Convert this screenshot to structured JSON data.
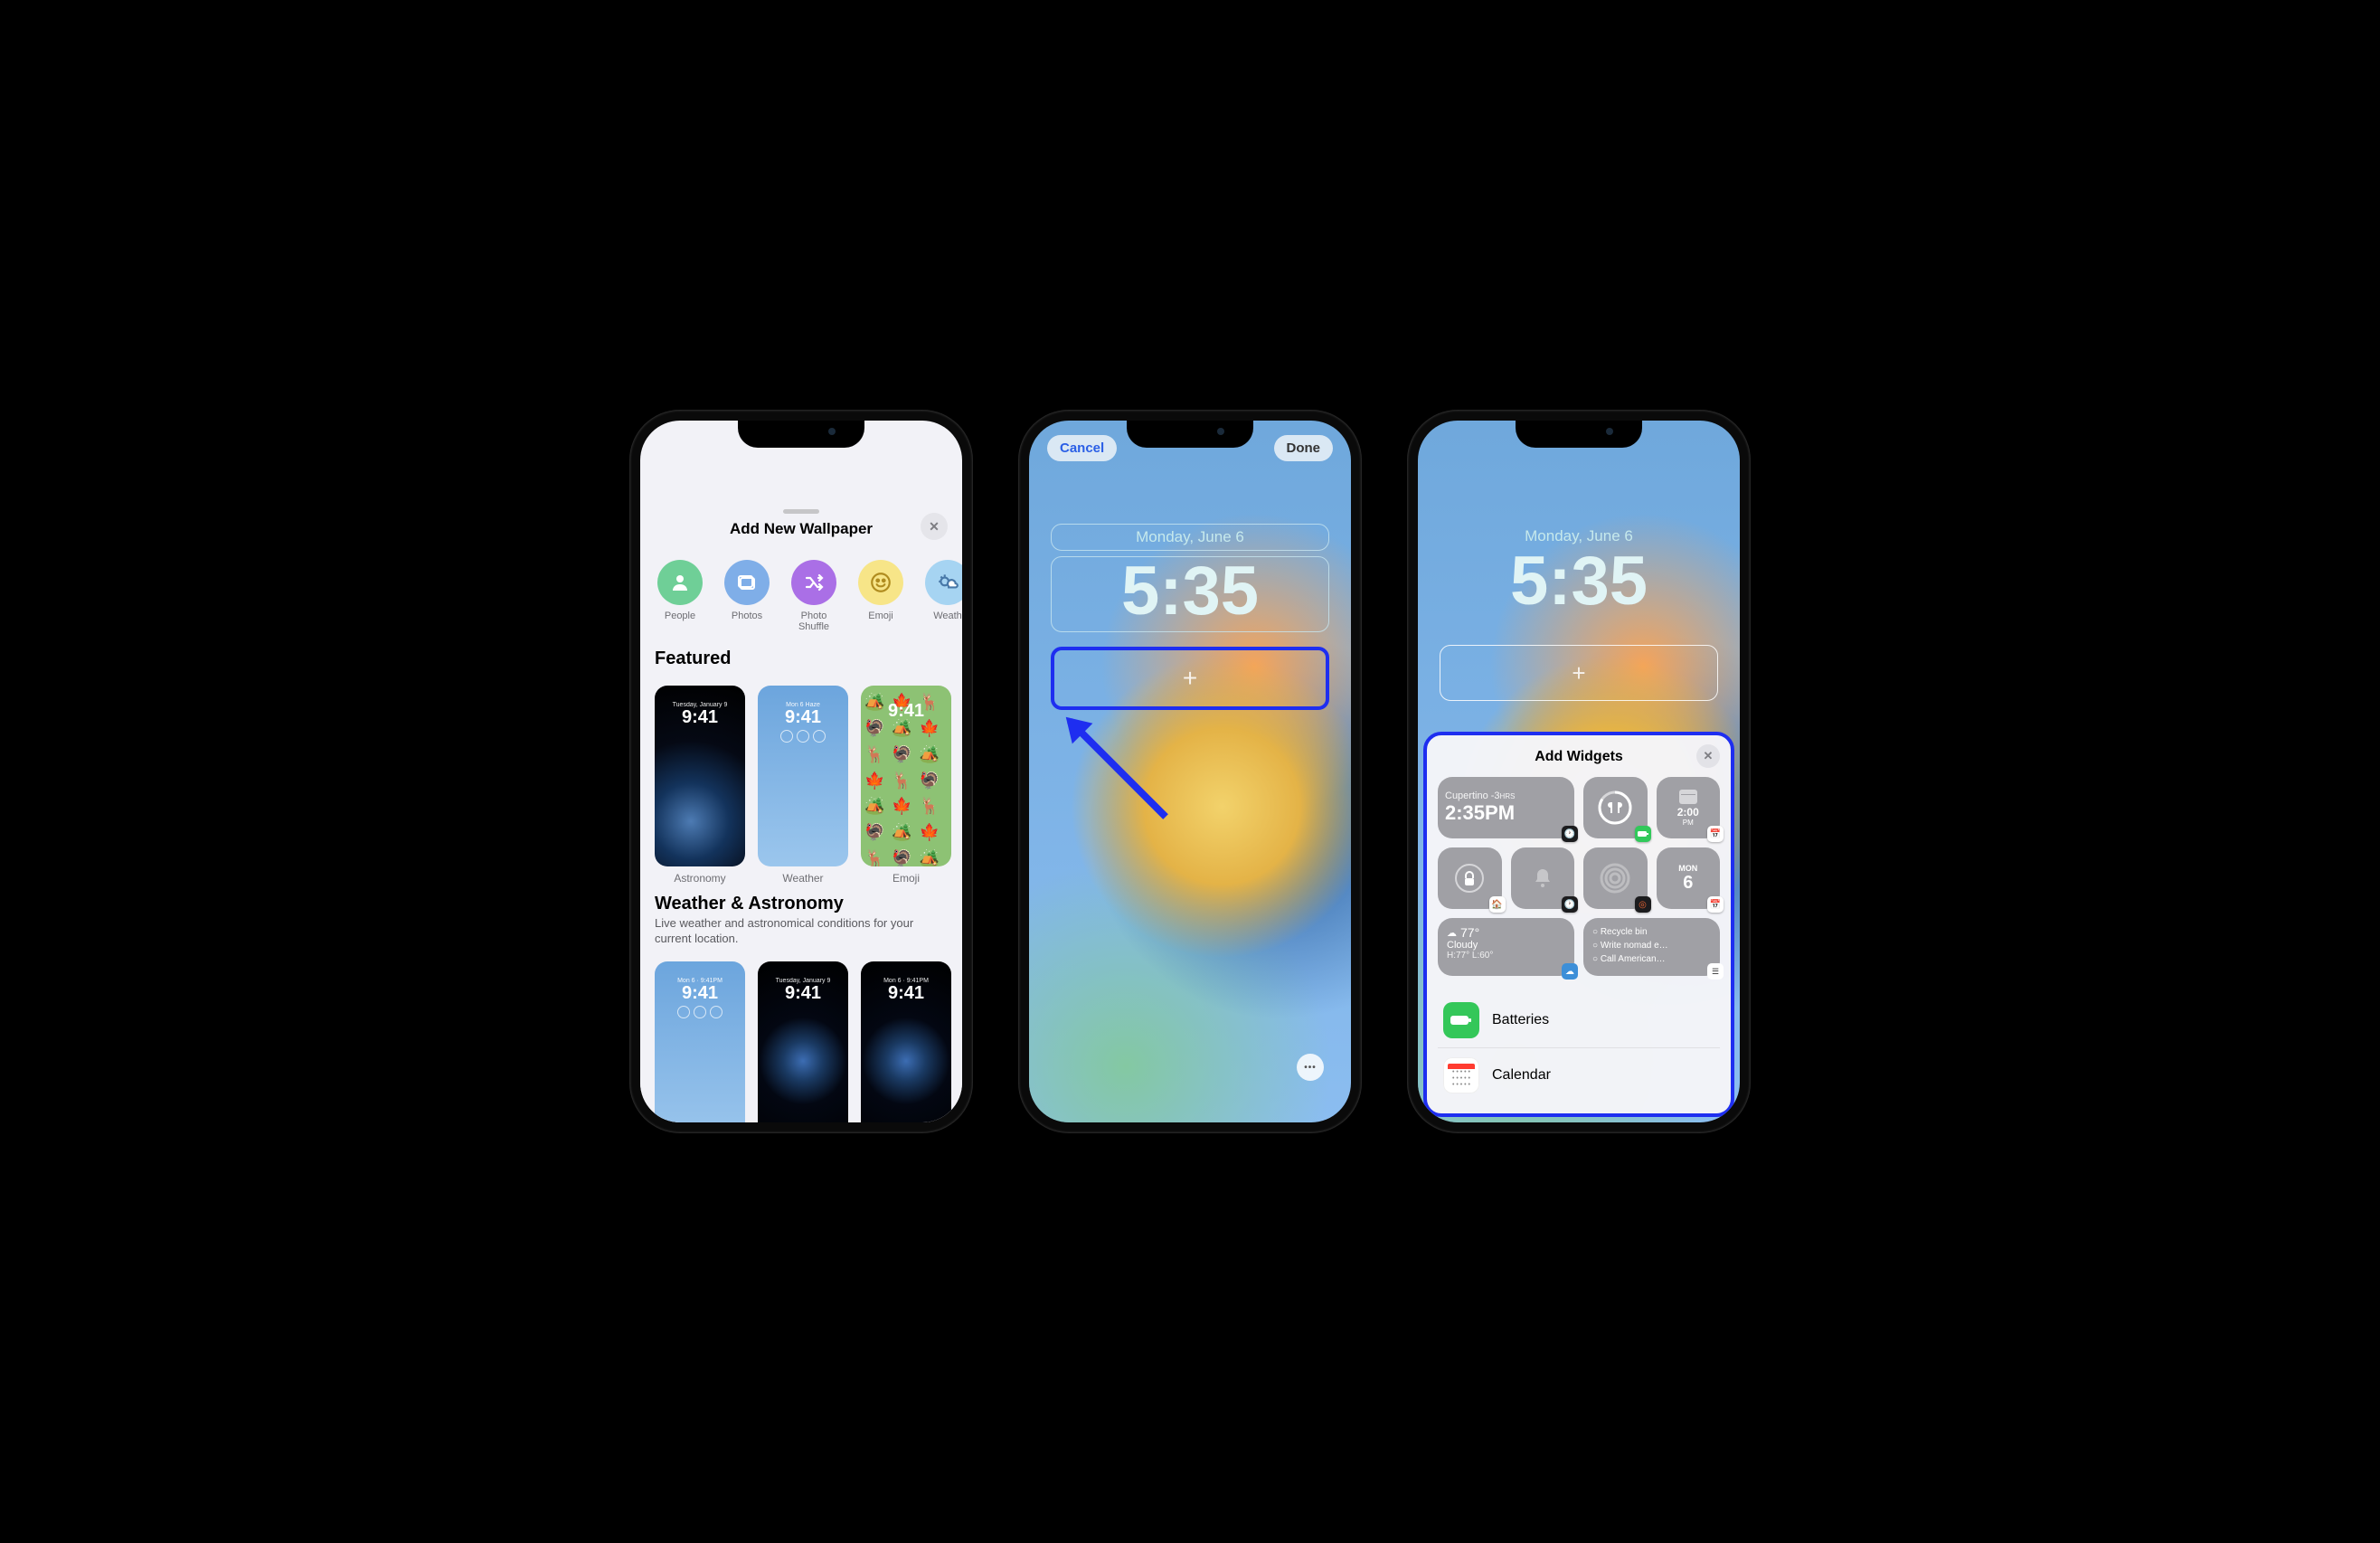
{
  "phone1": {
    "sheet_title": "Add New Wallpaper",
    "categories": [
      {
        "label": "People"
      },
      {
        "label": "Photos"
      },
      {
        "label": "Photo Shuffle"
      },
      {
        "label": "Emoji"
      },
      {
        "label": "Weath"
      }
    ],
    "featured": {
      "heading": "Featured",
      "items": [
        {
          "label": "Astronomy",
          "date": "Tuesday, January 9",
          "time": "9:41"
        },
        {
          "label": "Weather",
          "date": "Mon 6  Haze",
          "time": "9:41"
        },
        {
          "label": "Emoji",
          "date": "",
          "time": "9:41"
        }
      ]
    },
    "weather_astronomy": {
      "heading": "Weather & Astronomy",
      "subheading": "Live weather and astronomical conditions for your current location.",
      "items": [
        {
          "date": "Mon 6 · 9:41PM",
          "time": "9:41"
        },
        {
          "date": "Tuesday, January 9",
          "time": "9:41"
        },
        {
          "date": "Mon 6 · 9:41PM",
          "time": "9:41"
        }
      ]
    }
  },
  "phone2": {
    "cancel": "Cancel",
    "done": "Done",
    "date": "Monday, June 6",
    "time": "5:35"
  },
  "phone3": {
    "date": "Monday, June 6",
    "time": "5:35",
    "panel_title": "Add Widgets",
    "widgets": {
      "clock_city": "Cupertino",
      "clock_offset": "-3",
      "clock_offset_unit": "HRS",
      "clock_time": "2:35PM",
      "cal_small_time": "2:00",
      "cal_small_ampm": "PM",
      "cal_day": "MON",
      "cal_num": "6",
      "weather_temp": "77°",
      "weather_cond": "Cloudy",
      "weather_hilo": "H:77° L:60°",
      "reminders": [
        "Recycle bin",
        "Write nomad e…",
        "Call American…"
      ]
    },
    "apps": [
      {
        "label": "Batteries"
      },
      {
        "label": "Calendar"
      }
    ]
  }
}
